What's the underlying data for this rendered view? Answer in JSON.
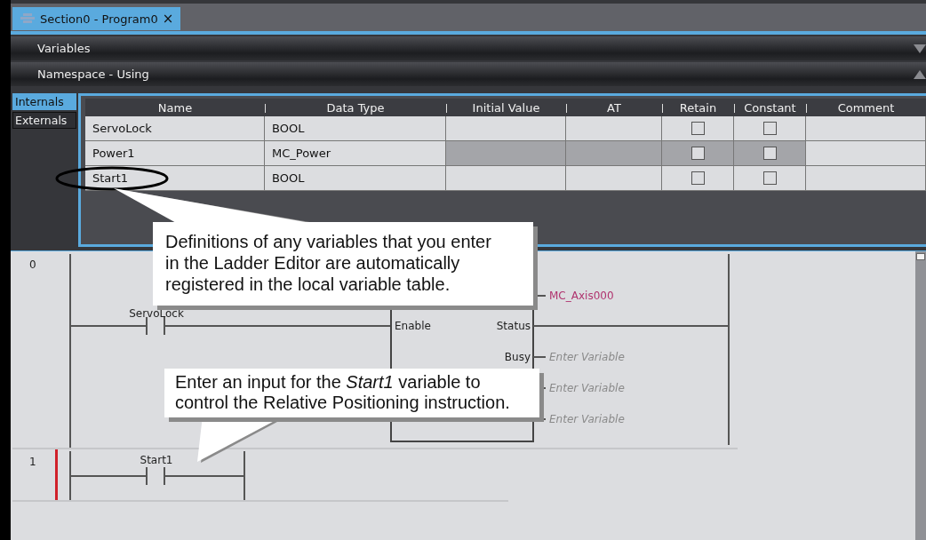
{
  "tab": {
    "title": "Section0 - Program0",
    "close": "×",
    "selected": true
  },
  "sections": [
    {
      "title": "Variables",
      "expanded": false
    },
    {
      "title": "Namespace - Using",
      "expanded": true
    }
  ],
  "variable_tabs": [
    {
      "label": "Internals",
      "selected": true
    },
    {
      "label": "Externals",
      "selected": false
    }
  ],
  "table": {
    "columns": [
      "Name",
      "Data Type",
      "Initial Value",
      "AT",
      "Retain",
      "Constant",
      "Comment"
    ],
    "rows": [
      {
        "name": "ServoLock",
        "data_type": "BOOL",
        "disabled": false,
        "retain": false,
        "constant": false
      },
      {
        "name": "Power1",
        "data_type": "MC_Power",
        "disabled": true,
        "retain": false,
        "constant": false
      },
      {
        "name": "Start1",
        "data_type": "BOOL",
        "disabled": false,
        "retain": false,
        "constant": false
      }
    ]
  },
  "ladder": {
    "rungs": [
      {
        "number": "0",
        "selected": false,
        "contact": "ServoLock",
        "block": {
          "input": "Enable",
          "axis": "MC_Axis000",
          "outputs": [
            {
              "label": "Status",
              "connected": true
            },
            {
              "label": "Busy",
              "connected": false,
              "placeholder": "Enter Variable"
            },
            {
              "connected": false,
              "placeholder": "Enter Variable"
            },
            {
              "connected": false,
              "placeholder": "Enter Variable"
            }
          ]
        }
      },
      {
        "number": "1",
        "selected": true,
        "contact": "Start1"
      }
    ]
  },
  "callouts": [
    {
      "text": "Definitions of any variables that you enter in the Ladder Editor are automatically registered in the local variable table."
    },
    {
      "text": "Enter an input for the *Start1* variable to control the Relative Positioning instruction."
    }
  ]
}
